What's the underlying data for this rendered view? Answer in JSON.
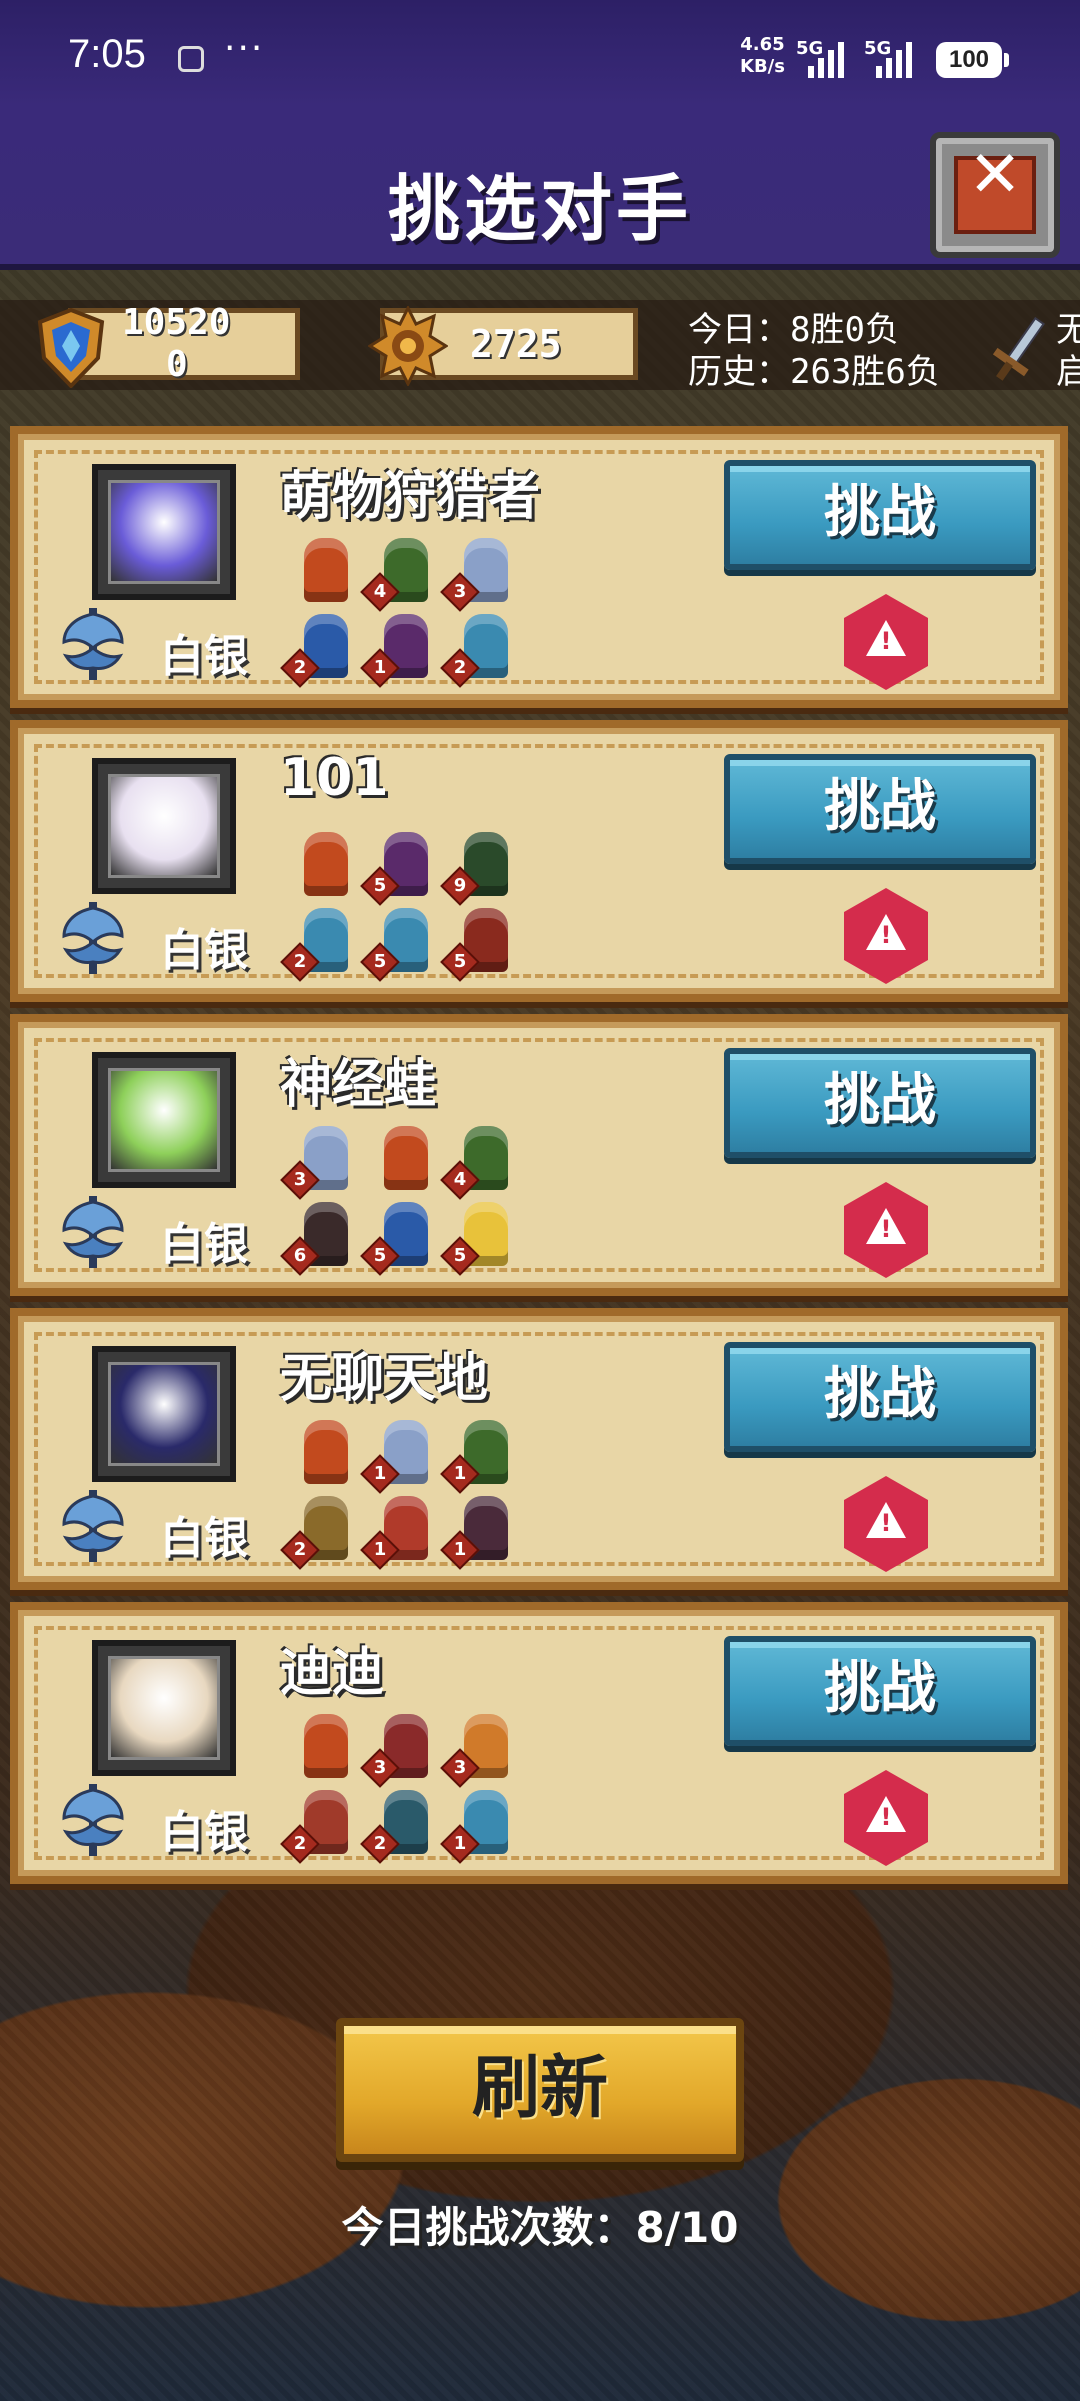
{
  "status_bar": {
    "time": "7:05",
    "more": "···",
    "net_speed_value": "4.65",
    "net_speed_unit": "KB/s",
    "signal1": "5G",
    "signal2": "5G",
    "battery": "100"
  },
  "header": {
    "title": "挑选对手",
    "close_icon": "close-icon"
  },
  "stats": {
    "trophy_score": "10520",
    "trophy_sub": "0",
    "medal_score": "2725",
    "today_record": "今日：8胜0负",
    "history_record": "历史：263胜6负",
    "cut_label_1": "无",
    "cut_label_2": "启"
  },
  "opponents": [
    {
      "name": "萌物狩猎者",
      "rank": "白银",
      "avatar_color": "#6a5cd8",
      "units": [
        {
          "level": "",
          "color": "#c24a1e"
        },
        {
          "level": "4",
          "color": "#3d6a2a"
        },
        {
          "level": "3",
          "color": "#8aa0c8"
        },
        {
          "level": "2",
          "color": "#2a5aa8"
        },
        {
          "level": "1",
          "color": "#5a2a6a"
        },
        {
          "level": "2",
          "color": "#3a8ab0"
        }
      ]
    },
    {
      "name": "101",
      "rank": "白银",
      "avatar_color": "#e8e0f0",
      "units": [
        {
          "level": "",
          "color": "#c24a1e"
        },
        {
          "level": "5",
          "color": "#5a2a6a"
        },
        {
          "level": "9",
          "color": "#2a4a2a"
        },
        {
          "level": "2",
          "color": "#3a8ab0"
        },
        {
          "level": "5",
          "color": "#3a8ab0"
        },
        {
          "level": "5",
          "color": "#8a2a1e"
        }
      ]
    },
    {
      "name": "神经蛙",
      "rank": "白银",
      "avatar_color": "#8ed05a",
      "units": [
        {
          "level": "3",
          "color": "#8aa0c8"
        },
        {
          "level": "",
          "color": "#c24a1e"
        },
        {
          "level": "4",
          "color": "#3d6a2a"
        },
        {
          "level": "6",
          "color": "#3a2a2a"
        },
        {
          "level": "5",
          "color": "#2a5aa8"
        },
        {
          "level": "5",
          "color": "#e8c23a"
        }
      ]
    },
    {
      "name": "无聊天地",
      "rank": "白银",
      "avatar_color": "#2a2a6a",
      "units": [
        {
          "level": "",
          "color": "#c24a1e"
        },
        {
          "level": "1",
          "color": "#8aa0c8"
        },
        {
          "level": "1",
          "color": "#3d6a2a"
        },
        {
          "level": "2",
          "color": "#8a6a2a"
        },
        {
          "level": "1",
          "color": "#b03a2a"
        },
        {
          "level": "1",
          "color": "#4a2a3a"
        }
      ]
    },
    {
      "name": "迪迪",
      "rank": "白银",
      "avatar_color": "#e8d8c0",
      "units": [
        {
          "level": "",
          "color": "#c24a1e"
        },
        {
          "level": "3",
          "color": "#8a2a2a"
        },
        {
          "level": "3",
          "color": "#d07a2a"
        },
        {
          "level": "2",
          "color": "#a03a2a"
        },
        {
          "level": "2",
          "color": "#2a5a6a"
        },
        {
          "level": "1",
          "color": "#3a8ab0"
        }
      ]
    }
  ],
  "challenge_label": "挑战",
  "report_icon": "warning-icon",
  "refresh_label": "刷新",
  "daily_count": "今日挑战次数：8/10"
}
